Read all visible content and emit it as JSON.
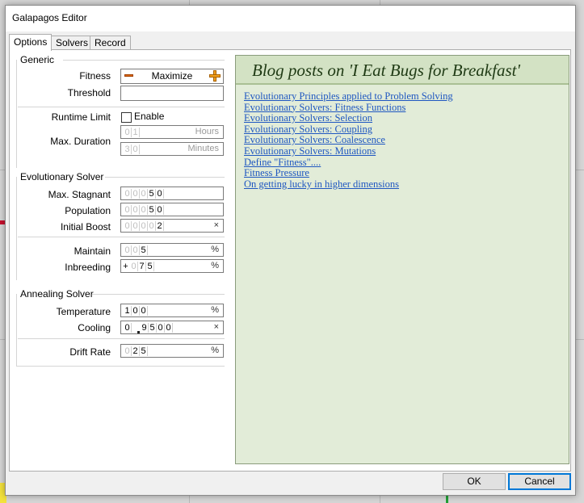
{
  "window": {
    "title": "Galapagos Editor"
  },
  "tabs": [
    {
      "label": "Options",
      "active": true
    },
    {
      "label": "Solvers",
      "active": false
    },
    {
      "label": "Record",
      "active": false
    }
  ],
  "generic": {
    "title": "Generic",
    "fitness_label": "Fitness",
    "fitness_value": "Maximize",
    "threshold_label": "Threshold",
    "threshold_value": "",
    "runtime_label": "Runtime Limit",
    "runtime_checkbox_label": "Enable",
    "runtime_enabled": false,
    "max_duration_label": "Max. Duration",
    "hours_digits": [
      "0",
      "1"
    ],
    "hours_unit": "Hours",
    "minutes_digits": [
      "3",
      "0"
    ],
    "minutes_unit": "Minutes"
  },
  "evolutionary": {
    "title": "Evolutionary Solver",
    "max_stagnant_label": "Max. Stagnant",
    "max_stagnant_digits": [
      "0",
      "0",
      "0",
      "5",
      "0"
    ],
    "population_label": "Population",
    "population_digits": [
      "0",
      "0",
      "0",
      "5",
      "0"
    ],
    "initial_boost_label": "Initial Boost",
    "initial_boost_digits": [
      "0",
      "0",
      "0",
      "0",
      "2"
    ],
    "initial_boost_unit": "×",
    "maintain_label": "Maintain",
    "maintain_digits": [
      "0",
      "0",
      "5"
    ],
    "maintain_unit": "%",
    "inbreeding_label": "Inbreeding",
    "inbreeding_sign": "+",
    "inbreeding_digits": [
      "0",
      "7",
      "5"
    ],
    "inbreeding_unit": "%"
  },
  "annealing": {
    "title": "Annealing Solver",
    "temperature_label": "Temperature",
    "temperature_digits": [
      "1",
      "0",
      "0"
    ],
    "temperature_unit": "%",
    "cooling_label": "Cooling",
    "cooling_int": "0",
    "cooling_digits": [
      "9",
      "5",
      "0",
      "0"
    ],
    "cooling_unit": "×",
    "drift_label": "Drift Rate",
    "drift_digits": [
      "0",
      "2",
      "5"
    ],
    "drift_unit": "%"
  },
  "blog": {
    "title": "Blog posts on 'I Eat Bugs for Breakfast'",
    "links": [
      "Evolutionary Principles applied to Problem Solving",
      "Evolutionary Solvers: Fitness Functions",
      "Evolutionary Solvers: Selection",
      "Evolutionary Solvers: Coupling",
      "Evolutionary Solvers: Coalescence",
      "Evolutionary Solvers: Mutations",
      "Define \"Fitness\"....",
      "Fitness Pressure",
      "On getting lucky in higher dimensions"
    ]
  },
  "buttons": {
    "ok": "OK",
    "cancel": "Cancel"
  },
  "colors": {
    "blog_bg": "#e2ecd8",
    "link": "#1f57c1",
    "default_button_border": "#0078d7"
  }
}
